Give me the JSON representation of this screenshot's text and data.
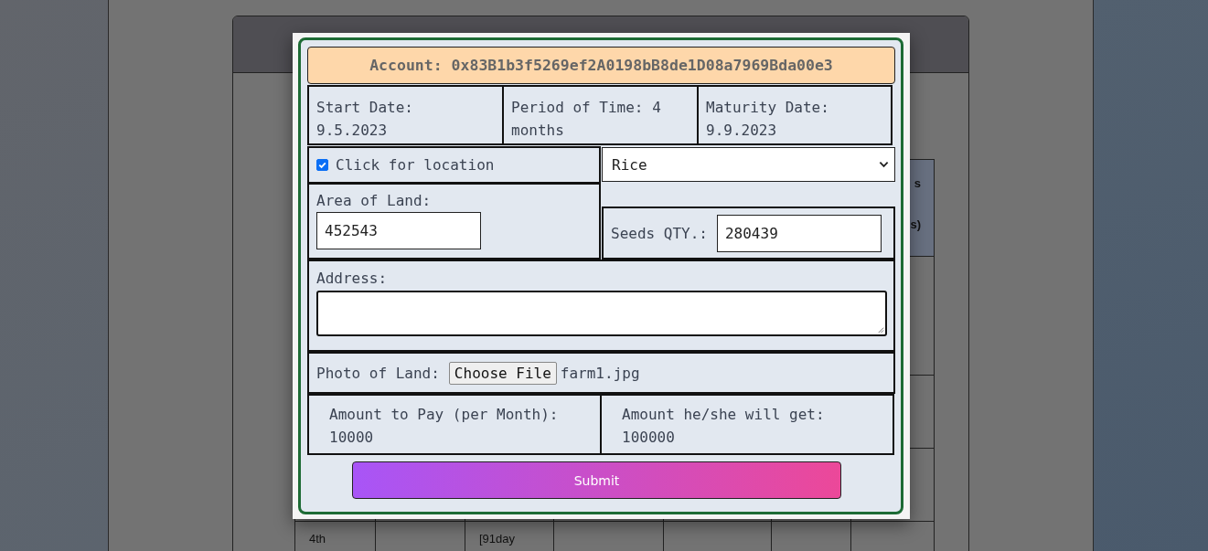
{
  "background_table": {
    "header_fragments": [
      "s",
      "s)"
    ],
    "last_row": {
      "column_1": "4th",
      "column_3": "[91day"
    }
  },
  "modal": {
    "account": "Account: 0x83B1b3f5269ef2A0198bB8de1D08a7969Bda00e3",
    "dates": [
      "Start Date: 9.5.2023",
      "Period of Time: 4 months",
      "Maturity Date: 9.9.2023"
    ],
    "location": {
      "label": "Click for location",
      "checked": true
    },
    "crop_select": {
      "value": "Rice"
    },
    "area": {
      "label": "Area of Land:",
      "value": "452543"
    },
    "seeds": {
      "label": "Seeds QTY.:",
      "value": "280439"
    },
    "address": {
      "label": "Address:"
    },
    "photo": {
      "label": "Photo of Land:",
      "button": "Choose File",
      "file_name": "farm1.jpg"
    },
    "amounts": [
      {
        "label": "Amount to Pay (per Month):",
        "value": "10000"
      },
      {
        "label": "Amount he/she will get:",
        "value": "100000"
      }
    ],
    "submit": "Submit"
  }
}
